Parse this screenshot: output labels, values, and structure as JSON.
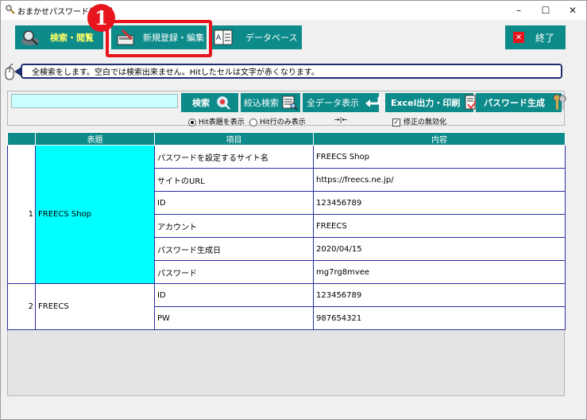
{
  "window": {
    "title": "おまかせパスワード備忘録",
    "minimize": "–",
    "maximize": "☐",
    "close": "✕"
  },
  "toolbar": {
    "search_browse": "検索・閲覧",
    "new_edit": "新規登録・編集",
    "database": "データベース",
    "exit": "終了"
  },
  "annotation": {
    "step": "1"
  },
  "message": "全検索をします。空白では検索出来ません。Hitしたセルは文字が赤くなります。",
  "search": {
    "input_value": "",
    "search_button": "検索",
    "filter_button": "絞込検索",
    "show_all_button": "全データ表示",
    "excel_button": "Excel出力・印刷",
    "password_gen_button": "パスワード生成",
    "radio_title": "Hit表題を表示",
    "radio_row": "Hit行のみ表示",
    "arrows": "→|←",
    "checkbox_label": "修正の無効化"
  },
  "grid": {
    "headers": [
      "表題",
      "項目",
      "内容"
    ],
    "records": [
      {
        "num": "1",
        "title": "FREECS Shop",
        "items": [
          {
            "label": "パスワードを設定するサイト名",
            "value": "FREECS Shop"
          },
          {
            "label": "サイトのURL",
            "value": "https://freecs.ne.jp/"
          },
          {
            "label": "ID",
            "value": "123456789"
          },
          {
            "label": "アカウント",
            "value": "FREECS"
          },
          {
            "label": "パスワード生成日",
            "value": "2020/04/15"
          },
          {
            "label": "パスワード",
            "value": "mg7rg8mvee"
          }
        ]
      },
      {
        "num": "2",
        "title": "FREECS",
        "items": [
          {
            "label": "ID",
            "value": "123456789"
          },
          {
            "label": "PW",
            "value": "987654321"
          }
        ]
      }
    ]
  },
  "colors": {
    "teal": "#0d8a8a",
    "selected_cell": "#00ffff",
    "highlight": "#e8141e",
    "grid_border": "#2a2ea0"
  }
}
